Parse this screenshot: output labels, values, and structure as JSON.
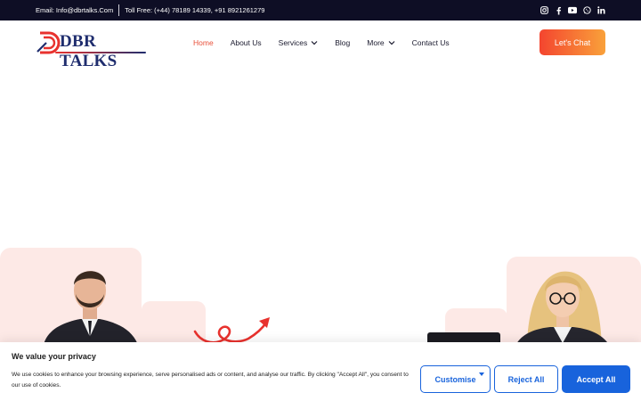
{
  "topbar": {
    "email": "Email: Info@dbrtalks.Com",
    "tollfree": "Toll Free: (+44) 78189 14339, +91 8921261279",
    "social_icons": [
      "instagram-icon",
      "facebook-icon",
      "youtube-icon",
      "whatsapp-icon",
      "linkedin-icon"
    ]
  },
  "header": {
    "logo_text": "DBR TALKS",
    "nav": [
      {
        "label": "Home",
        "active": true
      },
      {
        "label": "About Us"
      },
      {
        "label": "Services",
        "dropdown": true
      },
      {
        "label": "Blog"
      },
      {
        "label": "More",
        "dropdown": true
      },
      {
        "label": "Contact Us"
      }
    ],
    "cta_label": "Let's Chat"
  },
  "cookie": {
    "title": "We value your privacy",
    "text": "We use cookies to enhance your browsing experience, serve personalised ads or content, and analyse our traffic. By clicking \"Accept All\", you consent to our use of cookies.",
    "customise_label": "Customise",
    "reject_label": "Reject All",
    "accept_label": "Accept All"
  },
  "colors": {
    "topbar_bg": "#0e0e25",
    "accent_red": "#e8322e",
    "cta_start": "#f4452f",
    "cta_end": "#f9a13a",
    "brand_blue": "#1f2d6e",
    "consent_blue": "#1863dc",
    "card_pink": "#fde9e6"
  }
}
